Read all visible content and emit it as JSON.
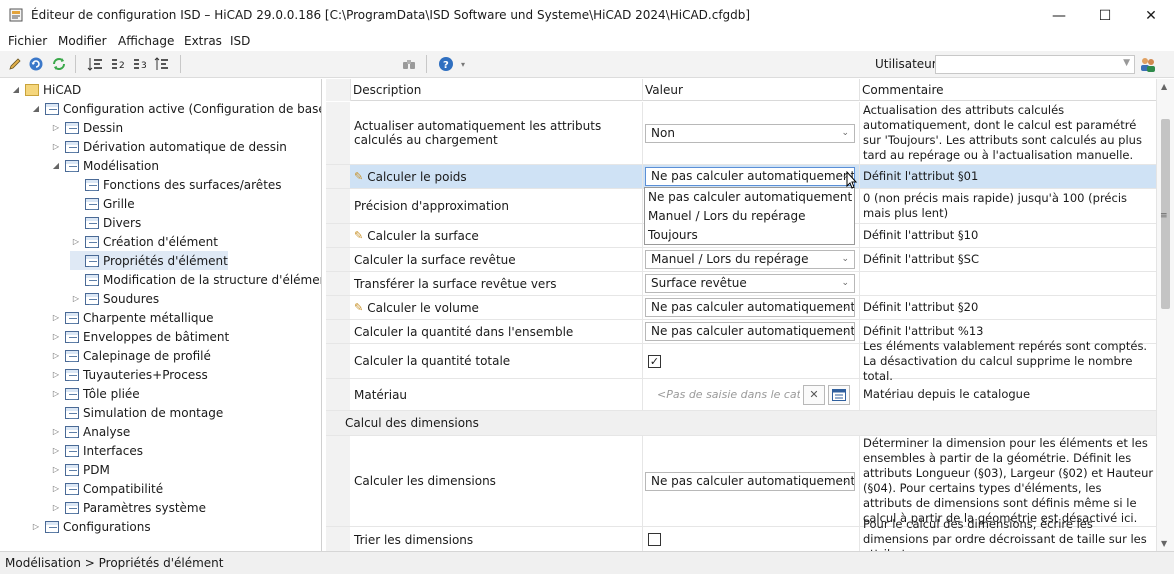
{
  "window": {
    "title": "Éditeur de configuration ISD – HiCAD 29.0.0.186 [C:\\ProgramData\\ISD Software und Systeme\\HiCAD 2024\\HiCAD.cfgdb]",
    "minimize": "—",
    "maximize": "☐",
    "close": "✕"
  },
  "menu": [
    "Fichier",
    "Modifier",
    "Affichage",
    "Extras",
    "ISD"
  ],
  "toolbar": {
    "user_label": "Utilisateur",
    "user_value": ""
  },
  "tree": [
    {
      "label": "HiCAD",
      "level": 0,
      "expander": "◢",
      "icon": "folder"
    },
    {
      "label": "Configuration active (Configuration de base)",
      "level": 1,
      "expander": "◢",
      "icon": "table"
    },
    {
      "label": "Dessin",
      "level": 2,
      "expander": "▷",
      "icon": "table"
    },
    {
      "label": "Dérivation automatique de dessin",
      "level": 2,
      "expander": "▷",
      "icon": "table"
    },
    {
      "label": "Modélisation",
      "level": 2,
      "expander": "◢",
      "icon": "table"
    },
    {
      "label": "Fonctions des surfaces/arêtes",
      "level": 3,
      "expander": "",
      "icon": "table"
    },
    {
      "label": "Grille",
      "level": 3,
      "expander": "",
      "icon": "table"
    },
    {
      "label": "Divers",
      "level": 3,
      "expander": "",
      "icon": "table"
    },
    {
      "label": "Création d'élément",
      "level": 3,
      "expander": "▷",
      "icon": "table"
    },
    {
      "label": "Propriétés d'élément",
      "level": 3,
      "expander": "",
      "icon": "table",
      "selected": true
    },
    {
      "label": "Modification de la structure d'élément",
      "level": 3,
      "expander": "",
      "icon": "table"
    },
    {
      "label": "Soudures",
      "level": 3,
      "expander": "▷",
      "icon": "table"
    },
    {
      "label": "Charpente métallique",
      "level": 2,
      "expander": "▷",
      "icon": "table"
    },
    {
      "label": "Enveloppes de bâtiment",
      "level": 2,
      "expander": "▷",
      "icon": "table"
    },
    {
      "label": "Calepinage de profilé",
      "level": 2,
      "expander": "▷",
      "icon": "table"
    },
    {
      "label": "Tuyauteries+Process",
      "level": 2,
      "expander": "▷",
      "icon": "table"
    },
    {
      "label": "Tôle pliée",
      "level": 2,
      "expander": "▷",
      "icon": "table"
    },
    {
      "label": "Simulation de montage",
      "level": 2,
      "expander": "",
      "icon": "table"
    },
    {
      "label": "Analyse",
      "level": 2,
      "expander": "▷",
      "icon": "table"
    },
    {
      "label": "Interfaces",
      "level": 2,
      "expander": "▷",
      "icon": "table"
    },
    {
      "label": "PDM",
      "level": 2,
      "expander": "▷",
      "icon": "table"
    },
    {
      "label": "Compatibilité",
      "level": 2,
      "expander": "▷",
      "icon": "table"
    },
    {
      "label": "Paramètres système",
      "level": 2,
      "expander": "▷",
      "icon": "table"
    },
    {
      "label": "Configurations",
      "level": 1,
      "expander": "▷",
      "icon": "table"
    }
  ],
  "grid": {
    "headers": [
      "Description",
      "Valeur",
      "Commentaire"
    ],
    "rows": [
      {
        "desc": "Actualiser automatiquement les attributs calculés au chargement",
        "value": "Non",
        "kind": "combo",
        "comment": "Actualisation des attributs calculés automatiquement, dont le calcul est paramétré sur 'Toujours'. Les attributs sont calculés au plus tard au repérage ou à l'actualisation manuelle."
      },
      {
        "desc": "Calculer le poids",
        "value": "Ne pas calculer automatiquement",
        "kind": "combo-open",
        "comment": "Définit l'attribut §01",
        "pencil": true
      },
      {
        "desc": "Précision d'approximation",
        "value": "",
        "kind": "hidden",
        "comment": "0 (non précis mais rapide) jusqu'à 100 (précis mais plus lent)"
      },
      {
        "desc": "Calculer la surface",
        "value": "",
        "kind": "hidden",
        "comment": "Définit l'attribut §10",
        "pencil": true
      },
      {
        "desc": "Calculer la surface revêtue",
        "value": "Manuel / Lors du repérage",
        "kind": "combo",
        "comment": "Définit l'attribut §SC"
      },
      {
        "desc": "Transférer la surface revêtue vers",
        "value": "Surface revêtue",
        "kind": "combo",
        "comment": ""
      },
      {
        "desc": "Calculer le volume",
        "value": "Ne pas calculer automatiquement",
        "kind": "combo",
        "comment": "Définit l'attribut §20",
        "pencil": true
      },
      {
        "desc": "Calculer la quantité dans l'ensemble",
        "value": "Ne pas calculer automatiquement",
        "kind": "combo",
        "comment": "Définit l'attribut %13"
      },
      {
        "desc": "Calculer la quantité totale",
        "value": "✓",
        "kind": "checkbox",
        "comment": "Les éléments valablement repérés sont comptés. La désactivation du calcul supprime le nombre total."
      },
      {
        "desc": "Matériau",
        "value": "<Pas de saisie dans le cata",
        "kind": "material",
        "comment": "Matériau depuis le catalogue"
      },
      {
        "desc": "Calcul des dimensions",
        "kind": "section"
      },
      {
        "desc": "Calculer les dimensions",
        "value": "Ne pas calculer automatiquement",
        "kind": "combo",
        "comment": "Déterminer la dimension pour les éléments et les ensembles à partir de la géométrie. Définit les attributs Longueur (§03), Largeur (§02) et Hauteur (§04). Pour certains types d'éléments, les attributs de dimensions sont définis même si le calcul à partir de la géométrie est désactivé ici."
      },
      {
        "desc": "Trier les dimensions",
        "value": "",
        "kind": "checkbox-empty",
        "comment": "Pour le calcul des dimensions, écrire les dimensions par ordre décroissant de taille sur les attributs"
      }
    ]
  },
  "dropdown_options": [
    "Ne pas calculer automatiquement",
    "Manuel / Lors du repérage",
    "Toujours"
  ],
  "status": "Modélisation > Propriétés d'élément"
}
